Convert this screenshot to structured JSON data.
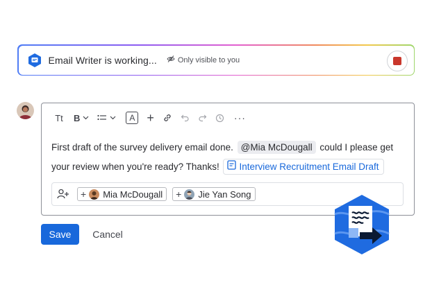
{
  "agent_bar": {
    "title": "Email Writer is working...",
    "visibility_label": "Only visible to you",
    "icons": {
      "agent": "agent-logo-icon",
      "visibility": "eye-off-icon",
      "stop": "stop-icon"
    }
  },
  "toolbar": {
    "text_size_label": "Tt",
    "bold_label": "B",
    "color_label": "A",
    "plus_label": "+",
    "more_label": "···",
    "icons": [
      "text-size-icon",
      "bold-icon",
      "bullet-list-icon",
      "text-color-icon",
      "insert-icon",
      "link-icon",
      "undo-icon",
      "redo-icon",
      "history-icon",
      "more-icon"
    ]
  },
  "message": {
    "part1": "First draft of the survey delivery email done. ",
    "mention": "@Mia McDougall",
    "part2": " could I please get your review when you're ready? Thanks! ",
    "link_label": "Interview Recruitment Email Draft"
  },
  "reviewers": {
    "icon": "add-person-icon",
    "people": [
      {
        "name": "Mia McDougall"
      },
      {
        "name": "Jie Yan Song"
      }
    ]
  },
  "actions": {
    "save_label": "Save",
    "cancel_label": "Cancel"
  },
  "colors": {
    "primary": "#1868db",
    "stop": "#c9372c",
    "hex_fill": "#1f6be0"
  }
}
